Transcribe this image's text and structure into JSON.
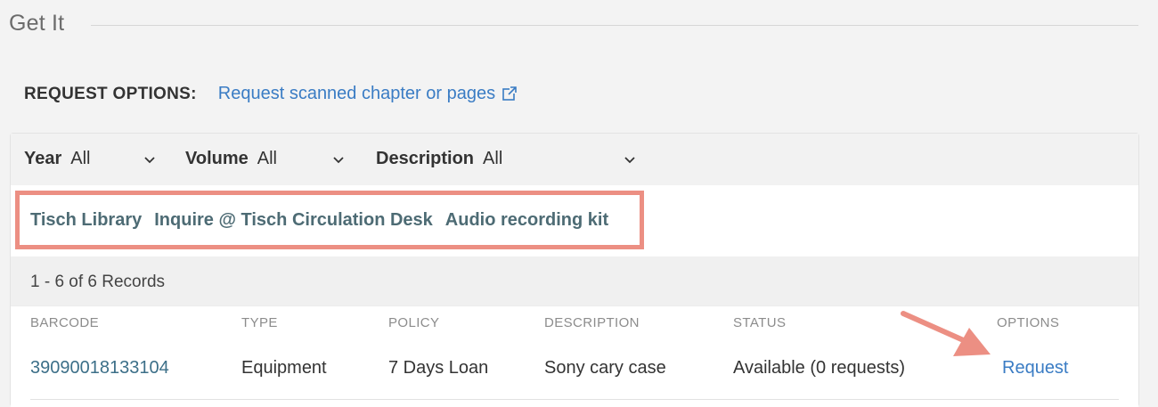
{
  "section": {
    "title": "Get It"
  },
  "request_options": {
    "label": "REQUEST OPTIONS:",
    "link": "Request scanned chapter or pages",
    "link_icon": "external-link-icon"
  },
  "filters": [
    {
      "label": "Year",
      "value": "All"
    },
    {
      "label": "Volume",
      "value": "All"
    },
    {
      "label": "Description",
      "value": "All"
    }
  ],
  "location": {
    "library": "Tisch Library",
    "desk": "Inquire @ Tisch Circulation Desk",
    "item": "Audio recording kit"
  },
  "records": {
    "count_text": "1 - 6 of 6 Records"
  },
  "table": {
    "headers": [
      "BARCODE",
      "TYPE",
      "POLICY",
      "DESCRIPTION",
      "STATUS",
      "OPTIONS"
    ],
    "rows": [
      {
        "barcode": "39090018133104",
        "type": "Equipment",
        "policy": "7 Days Loan",
        "description": "Sony cary case",
        "status": "Available (0 requests)",
        "option": "Request"
      }
    ]
  },
  "colors": {
    "highlight": "#ec8f83",
    "link": "#3a7cc4",
    "location_text": "#4d6b74"
  }
}
